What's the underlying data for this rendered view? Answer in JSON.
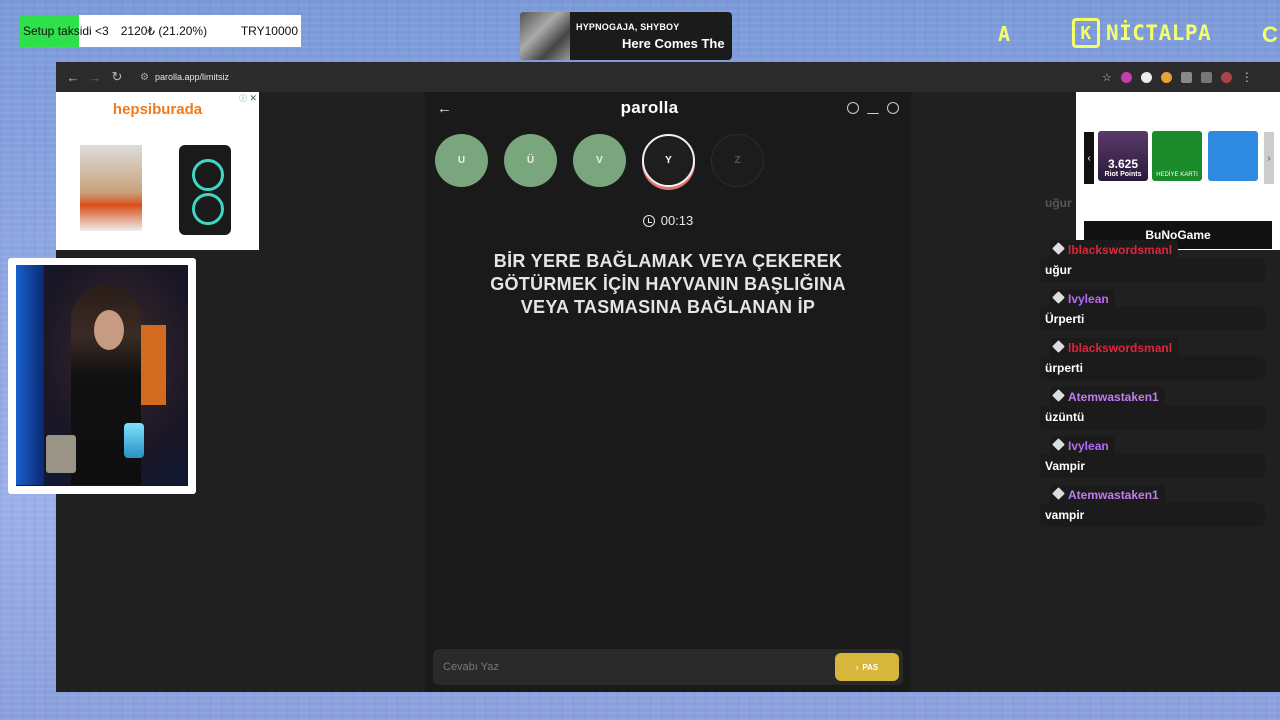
{
  "overlay": {
    "donation_label": "Setup taksidi <3",
    "donation_amount": "2120₺ (21.20%)",
    "donation_goal": "TRY10000",
    "donation_progress": 0.212,
    "music_artist": "HYPNOGAJA, SHYBOY",
    "music_title": "Here Comes The",
    "brand_letter": "A",
    "brand_name": "NİCTALPA",
    "brand_k": "K",
    "brand_tail": "C"
  },
  "browser": {
    "url": "parolla.app/limitsiz"
  },
  "ad_left": {
    "brand": "hepsiburada"
  },
  "ad_right": {
    "riot_tile": "3.625",
    "riot_sub": "Riot Points",
    "xbox_sub": "HEDİYE KARTI",
    "banner": "BuNoGame"
  },
  "game": {
    "title": "parolla",
    "letters": [
      {
        "char": "U",
        "state": "done"
      },
      {
        "char": "Ü",
        "state": "done"
      },
      {
        "char": "V",
        "state": "done"
      },
      {
        "char": "Y",
        "state": "active"
      },
      {
        "char": "Z",
        "state": "pending"
      }
    ],
    "timer": "00:13",
    "question": "BİR YERE BAĞLAMAK VEYA ÇEKEREK GÖTÜRMEK İÇİN HAYVANIN BAŞLIĞINA VEYA TASMASINA BAĞLANAN İP",
    "answer_placeholder": "Cevabı Yaz",
    "pas_label": "PAS"
  },
  "chat": {
    "ghost_text": "uğur",
    "messages": [
      {
        "user": "lblackswordsmanl",
        "color": "#e0243c",
        "text": "uğur"
      },
      {
        "user": "Ivylean",
        "color": "#b66cf5",
        "text": "Ürperti"
      },
      {
        "user": "lblackswordsmanl",
        "color": "#e0243c",
        "text": "ürperti"
      },
      {
        "user": "Atemwastaken1",
        "color": "#c07cf0",
        "text": "üzüntü"
      },
      {
        "user": "Ivylean",
        "color": "#b66cf5",
        "text": "Vampir"
      },
      {
        "user": "Atemwastaken1",
        "color": "#c07cf0",
        "text": "vampir"
      }
    ]
  },
  "colors": {
    "done": "#79a67c",
    "active_ring": "#e27272",
    "pas": "#d7b63c",
    "brand": "#f4ff6a"
  }
}
